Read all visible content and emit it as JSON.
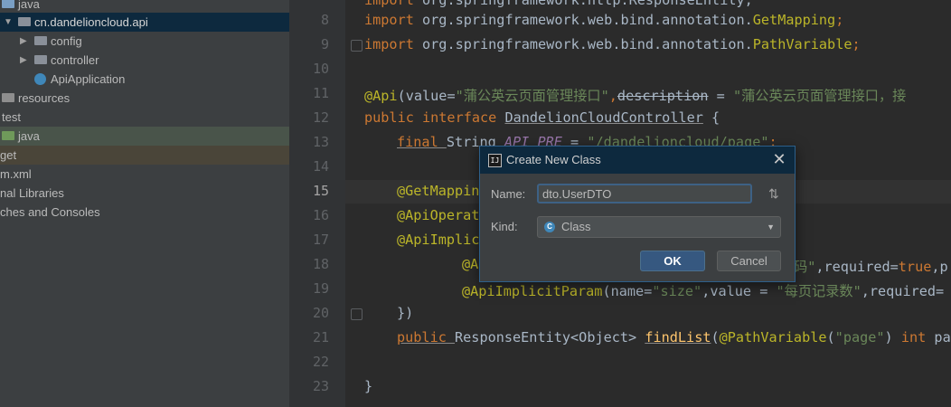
{
  "project_tree": {
    "items": [
      {
        "label": "java"
      },
      {
        "label": "cn.dandelioncloud.api"
      },
      {
        "label": "config"
      },
      {
        "label": "controller"
      },
      {
        "label": "ApiApplication"
      },
      {
        "label": "resources"
      },
      {
        "label": "test"
      },
      {
        "label": "java"
      },
      {
        "label": "get"
      },
      {
        "label": "m.xml"
      },
      {
        "label": "nal Libraries"
      },
      {
        "label": "ches and Consoles"
      }
    ]
  },
  "editor": {
    "line_numbers": [
      "8",
      "9",
      "10",
      "11",
      "12",
      "13",
      "14",
      "15",
      "16",
      "17",
      "18",
      "19",
      "20",
      "21",
      "22",
      "23"
    ],
    "lines": {
      "l8_kw": "import ",
      "l8_pkg": "org.springframework.web.bind.annotation.",
      "l8_cls": "GetMapping",
      "l8_end": ";",
      "l9_kw": "import ",
      "l9_pkg": "org.springframework.web.bind.annotation.",
      "l9_cls": "PathVariable",
      "l9_end": ";",
      "l11_an": "@Api",
      "l11_a": "(value=",
      "l11_s1": "\"蒲公英云页面管理接口\"",
      "l11_b": ",",
      "l11_desc": "description",
      "l11_c": " = ",
      "l11_s2": "\"蒲公英云页面管理接口，接",
      "l12_kw": "public interface ",
      "l12_name": "DandelionCloudController",
      "l12_end": " {",
      "l13_kw": "final ",
      "l13_type": "String ",
      "l13_const": "API_PRE",
      "l13_eq": " = ",
      "l13_str": "\"/dandelioncloud/page\"",
      "l13_end": ";",
      "l15_an": "@GetMappin",
      "l16_an": "@ApiOperat",
      "l17_an": "@ApiImplic",
      "l18_an": "@A",
      "l18_str": "码\"",
      "l18_rest": ",required=",
      "l18_kw": "true",
      "l18_end": ",p",
      "l19_an": "@ApiImplicitParam",
      "l19_a": "(name=",
      "l19_s1": "\"size\"",
      "l19_b": ",value = ",
      "l19_s2": "\"每页记录数\"",
      "l19_c": ",required=",
      "l20": "})",
      "l21_kw": "public ",
      "l21_type": "ResponseEntity<Object> ",
      "l21_fn": "findList",
      "l21_a": "(",
      "l21_an": "@PathVariable",
      "l21_b": "(",
      "l21_str": "\"page\"",
      "l21_c": ") ",
      "l21_kw2": "int ",
      "l21_d": "pag",
      "l23": "}"
    }
  },
  "dialog": {
    "title": "Create New Class",
    "close_glyph": "✕",
    "name_label": "Name:",
    "name_value": "dto.UserDTO",
    "sort_glyph": "⇅",
    "kind_label": "Kind:",
    "kind_icon": "C",
    "kind_value": "Class",
    "ok_label": "OK",
    "cancel_label": "Cancel"
  },
  "colors": {
    "editor_bg": "#2b2b2b",
    "tree_bg": "#3c3f41",
    "keyword": "#cc7832",
    "annotation": "#bbb529",
    "string": "#6a8759",
    "selection": "#0d293e"
  }
}
